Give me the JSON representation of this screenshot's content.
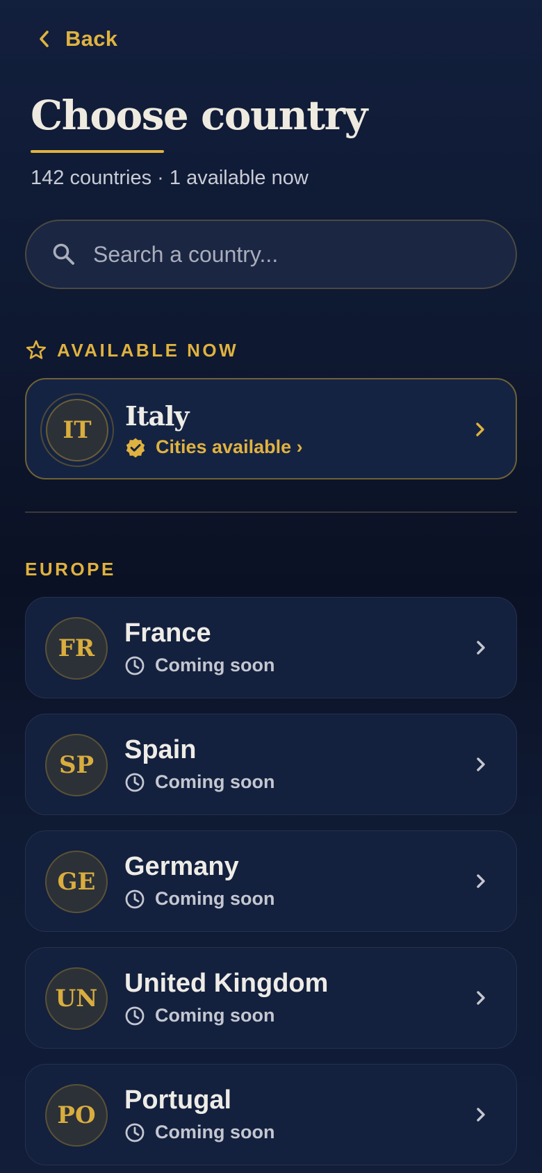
{
  "nav": {
    "back_label": "Back"
  },
  "header": {
    "title": "Choose country",
    "subtitle": "142 countries · 1 available now"
  },
  "search": {
    "placeholder": "Search a country..."
  },
  "available_section": {
    "heading": "AVAILABLE NOW",
    "country": {
      "code": "IT",
      "name": "Italy",
      "status": "Cities available ›"
    }
  },
  "europe_section": {
    "heading": "EUROPE",
    "countries": [
      {
        "code": "FR",
        "name": "France",
        "status": "Coming soon"
      },
      {
        "code": "SP",
        "name": "Spain",
        "status": "Coming soon"
      },
      {
        "code": "GE",
        "name": "Germany",
        "status": "Coming soon"
      },
      {
        "code": "UN",
        "name": "United Kingdom",
        "status": "Coming soon"
      },
      {
        "code": "PO",
        "name": "Portugal",
        "status": "Coming soon"
      }
    ]
  },
  "colors": {
    "accent": "#e0b23f",
    "background": "#0f1a33",
    "card": "#13203e"
  }
}
